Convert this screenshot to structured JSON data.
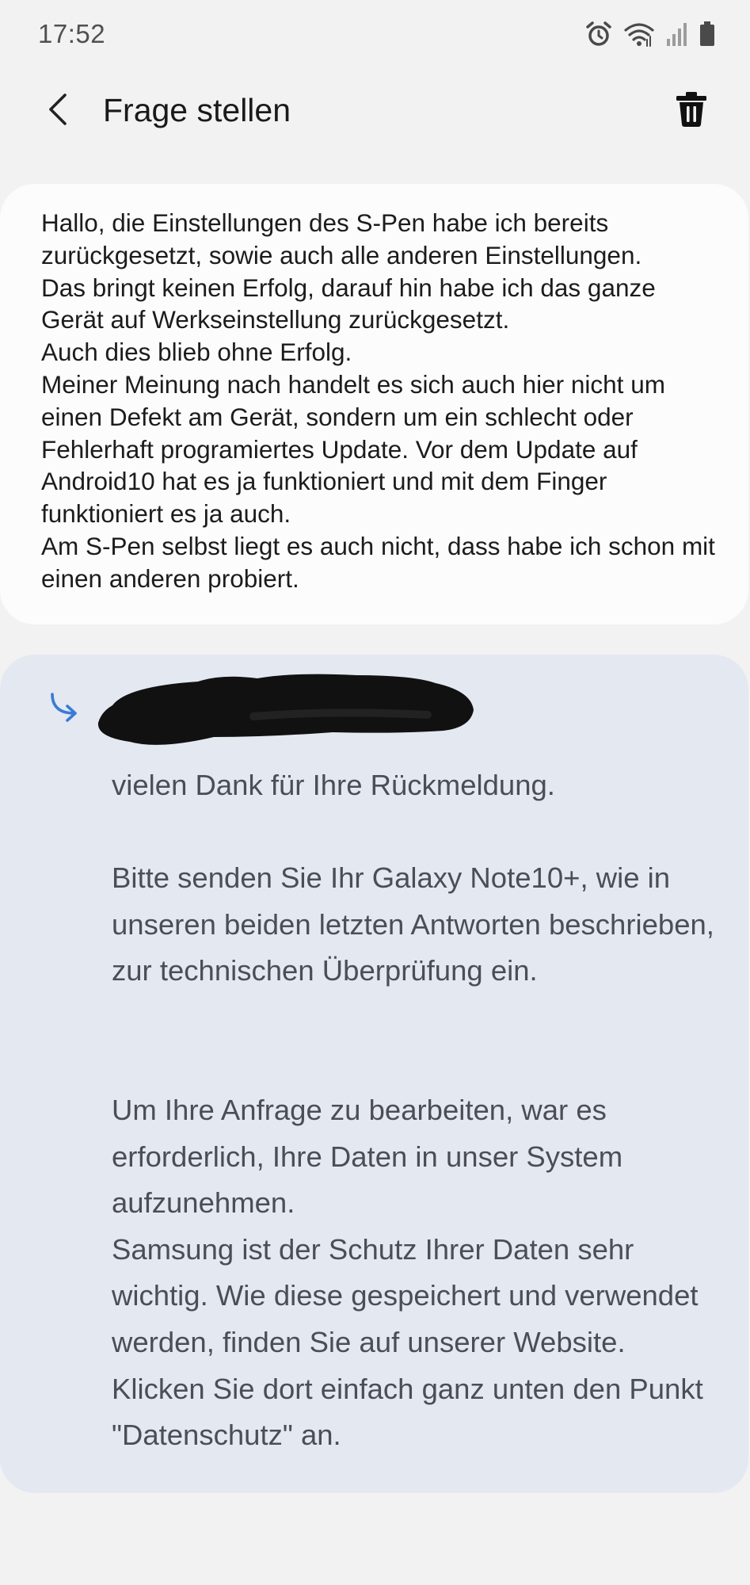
{
  "status_bar": {
    "time": "17:52",
    "icons": [
      "alarm-icon",
      "wifi-icon",
      "signal-icon",
      "battery-icon"
    ]
  },
  "header": {
    "title": "Frage stellen",
    "back_icon": "back-arrow-icon",
    "delete_icon": "trash-icon"
  },
  "question": {
    "text": "Hallo, die Einstellungen des S-Pen habe ich bereits zurückgesetzt, sowie auch alle anderen Einstellungen.\nDas bringt keinen Erfolg, darauf hin habe ich das ganze Gerät auf Werkseinstellung zurückgesetzt.\nAuch dies blieb ohne Erfolg.\nMeiner Meinung nach handelt es sich auch hier nicht um einen Defekt am Gerät, sondern um ein schlecht oder Fehlerhaft programiertes Update. Vor dem Update auf Android10 hat es ja funktioniert und mit dem Finger funktioniert es ja auch.\nAm S-Pen selbst liegt es auch nicht, dass habe ich schon mit einen anderen probiert."
  },
  "answer": {
    "reply_icon": "reply-arrow-icon",
    "paragraph_1": "vielen Dank für Ihre Rückmeldung.",
    "paragraph_2": "Bitte senden Sie Ihr Galaxy Note10+, wie in unseren beiden letzten Antworten beschrieben, zur technischen Überprüfung ein.",
    "paragraph_3": "Um Ihre Anfrage zu bearbeiten, war es erforderlich, Ihre Daten in unser System aufzunehmen.",
    "paragraph_4": "Samsung ist der Schutz Ihrer Daten sehr wichtig. Wie diese gespeichert und verwendet werden, finden Sie auf unserer Website. Klicken Sie dort einfach ganz unten den Punkt \"Datenschutz\" an."
  },
  "colors": {
    "background": "#f2f2f2",
    "question_card": "#fcfcfc",
    "answer_card": "#e4e8f1",
    "answer_text": "#4b4e57",
    "reply_accent": "#3a7bd5"
  }
}
